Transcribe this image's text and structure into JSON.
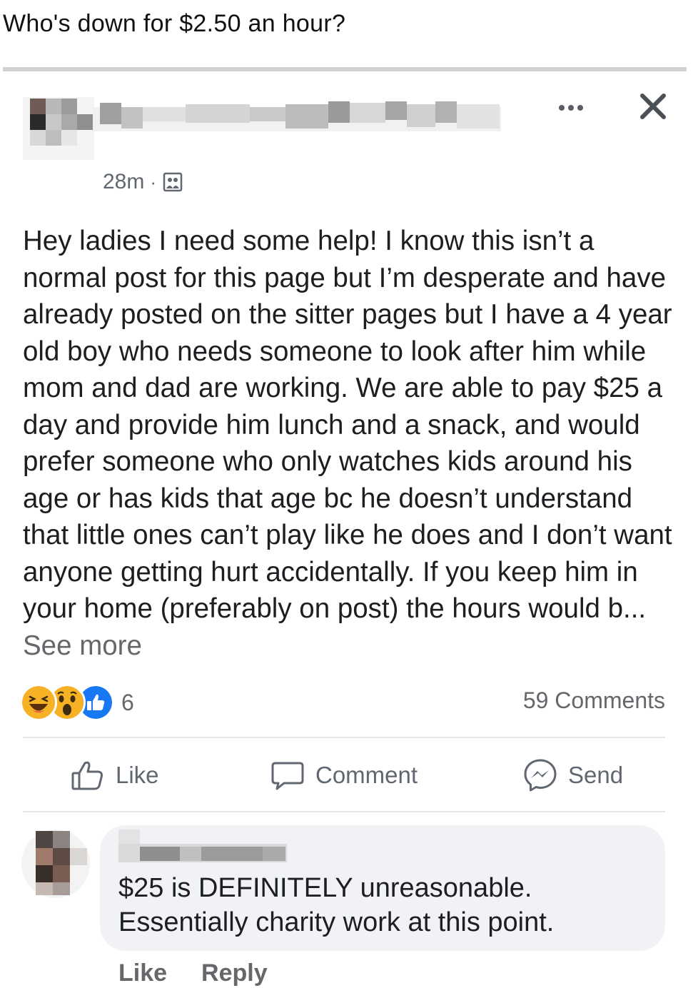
{
  "caption": "Who's down for $2.50 an hour?",
  "post": {
    "timestamp": "28m",
    "meta_separator": "·",
    "body_text": "Hey ladies I need some help! I know this isn’t a normal post for this page but I’m desperate and have already posted on the sitter pages but I have a 4 year old boy who needs someone to look after him while mom and dad are working. We are able to pay $25 a day and provide him lunch and a snack, and would prefer someone who only watches kids around his age or has kids that age bc he doesn’t understand that little ones can’t play like he does and I don’t want anyone getting hurt accidentally. If you keep him in your home (preferably on post) the hours would b...",
    "see_more": "See more",
    "reaction_count": "6",
    "comments_count": "59 Comments",
    "reactions": [
      "haha-reaction-icon",
      "wow-reaction-icon",
      "like-reaction-icon"
    ]
  },
  "actions": {
    "like": "Like",
    "comment": "Comment",
    "send": "Send"
  },
  "comment": {
    "text_line1": "$25 is DEFINITELY unreasonable.",
    "text_line2": "Essentially charity work at this point.",
    "like": "Like",
    "reply": "Reply"
  },
  "colors": {
    "muted_text": "#65676b",
    "bubble_bg": "#f0f2f5",
    "like_blue": "#1877f2",
    "reaction_yellow": "#f7b125"
  }
}
